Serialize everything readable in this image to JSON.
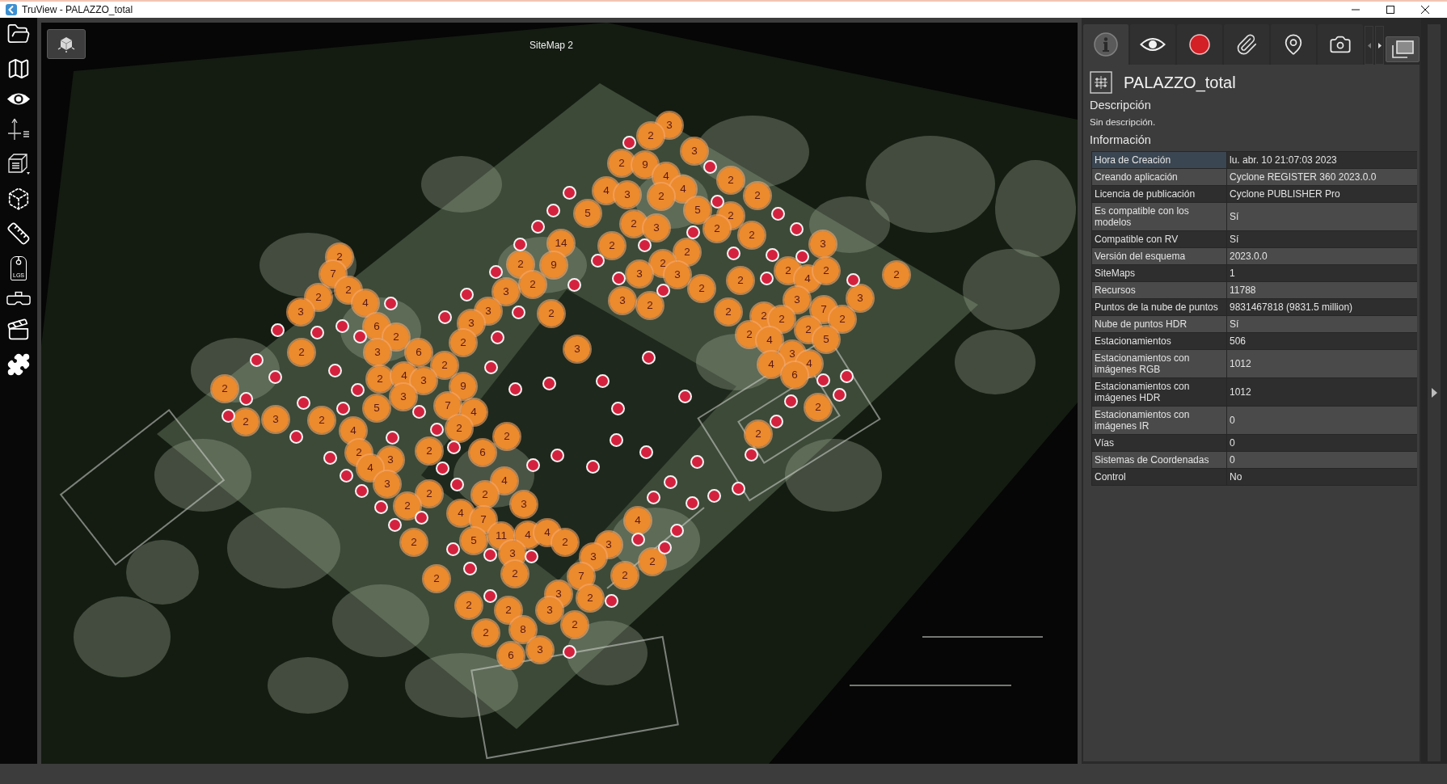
{
  "window": {
    "title": "TruView - PALAZZO_total"
  },
  "toolbar": {
    "tag_text": "LGS"
  },
  "viewport": {
    "sitemap_label": "SiteMap 2",
    "clusters": [
      {
        "count": "3"
      },
      {
        "count": "2"
      },
      {
        "count": "3"
      },
      {
        "count": "2"
      },
      {
        "count": "9"
      },
      {
        "count": "4"
      },
      {
        "count": "4"
      },
      {
        "count": "2"
      },
      {
        "count": "4"
      },
      {
        "count": "3"
      },
      {
        "count": "2"
      },
      {
        "count": "2"
      },
      {
        "count": "5"
      },
      {
        "count": "5"
      },
      {
        "count": "2"
      },
      {
        "count": "2"
      },
      {
        "count": "3"
      },
      {
        "count": "2"
      },
      {
        "count": "14"
      },
      {
        "count": "2"
      },
      {
        "count": "2"
      },
      {
        "count": "2"
      },
      {
        "count": "3"
      },
      {
        "count": "2"
      },
      {
        "count": "2"
      },
      {
        "count": "9"
      },
      {
        "count": "2"
      },
      {
        "count": "7"
      },
      {
        "count": "3"
      },
      {
        "count": "3"
      },
      {
        "count": "2"
      },
      {
        "count": "4"
      },
      {
        "count": "2"
      },
      {
        "count": "2"
      },
      {
        "count": "2"
      },
      {
        "count": "2"
      },
      {
        "count": "3"
      },
      {
        "count": "2"
      },
      {
        "count": "2"
      },
      {
        "count": "2"
      },
      {
        "count": "4"
      },
      {
        "count": "3"
      },
      {
        "count": "2"
      },
      {
        "count": "3"
      },
      {
        "count": "3"
      },
      {
        "count": "3"
      },
      {
        "count": "3"
      },
      {
        "count": "2"
      },
      {
        "count": "2"
      },
      {
        "count": "2"
      },
      {
        "count": "7"
      },
      {
        "count": "6"
      },
      {
        "count": "3"
      },
      {
        "count": "2"
      },
      {
        "count": "2"
      },
      {
        "count": "2"
      },
      {
        "count": "2"
      },
      {
        "count": "2"
      },
      {
        "count": "2"
      },
      {
        "count": "4"
      },
      {
        "count": "5"
      },
      {
        "count": "2"
      },
      {
        "count": "3"
      },
      {
        "count": "6"
      },
      {
        "count": "3"
      },
      {
        "count": "3"
      },
      {
        "count": "2"
      },
      {
        "count": "4"
      },
      {
        "count": "4"
      },
      {
        "count": "2"
      },
      {
        "count": "4"
      },
      {
        "count": "3"
      },
      {
        "count": "6"
      },
      {
        "count": "2"
      },
      {
        "count": "9"
      },
      {
        "count": "3"
      },
      {
        "count": "5"
      },
      {
        "count": "7"
      },
      {
        "count": "4"
      },
      {
        "count": "2"
      },
      {
        "count": "2"
      },
      {
        "count": "3"
      },
      {
        "count": "2"
      },
      {
        "count": "4"
      },
      {
        "count": "2"
      },
      {
        "count": "2"
      },
      {
        "count": "2"
      },
      {
        "count": "2"
      },
      {
        "count": "3"
      },
      {
        "count": "2"
      },
      {
        "count": "6"
      },
      {
        "count": "4"
      },
      {
        "count": "3"
      },
      {
        "count": "4"
      },
      {
        "count": "2"
      },
      {
        "count": "2"
      },
      {
        "count": "2"
      },
      {
        "count": "4"
      },
      {
        "count": "3"
      },
      {
        "count": "7"
      },
      {
        "count": "4"
      },
      {
        "count": "5"
      },
      {
        "count": "11"
      },
      {
        "count": "4"
      },
      {
        "count": "4"
      },
      {
        "count": "2"
      },
      {
        "count": "2"
      },
      {
        "count": "3"
      },
      {
        "count": "3"
      },
      {
        "count": "3"
      },
      {
        "count": "2"
      },
      {
        "count": "2"
      },
      {
        "count": "2"
      },
      {
        "count": "7"
      },
      {
        "count": "2"
      },
      {
        "count": "3"
      },
      {
        "count": "2"
      },
      {
        "count": "2"
      },
      {
        "count": "2"
      },
      {
        "count": "3"
      },
      {
        "count": "2"
      },
      {
        "count": "8"
      },
      {
        "count": "2"
      },
      {
        "count": "6"
      },
      {
        "count": "3"
      }
    ]
  },
  "panel": {
    "tabs": [
      {
        "selected": true
      },
      {
        "selected": false
      },
      {
        "selected": false
      },
      {
        "selected": false
      },
      {
        "selected": false
      },
      {
        "selected": false
      }
    ],
    "title": "PALAZZO_total",
    "description_heading": "Descripción",
    "description": "Sin descripción.",
    "info_heading": "Información",
    "info_rows": [
      {
        "label": "Hora de Creación",
        "value": "lu. abr. 10 21:07:03 2023",
        "selected": true
      },
      {
        "label": "Creando aplicación",
        "value": "Cyclone REGISTER 360 2023.0.0",
        "selected": false
      },
      {
        "label": "Licencia de publicación",
        "value": "Cyclone PUBLISHER Pro",
        "selected": false
      },
      {
        "label": "Es compatible con los modelos",
        "value": "Sí",
        "selected": false
      },
      {
        "label": "Compatible con RV",
        "value": "Sí",
        "selected": false
      },
      {
        "label": "Versión del esquema",
        "value": "2023.0.0",
        "selected": false
      },
      {
        "label": "SiteMaps",
        "value": "1",
        "selected": false
      },
      {
        "label": "Recursos",
        "value": "11788",
        "selected": false
      },
      {
        "label": "Puntos de la nube de puntos",
        "value": "9831467818 (9831.5 million)",
        "selected": false
      },
      {
        "label": "Nube de puntos HDR",
        "value": "Sí",
        "selected": false
      },
      {
        "label": "Estacionamientos",
        "value": "506",
        "selected": false
      },
      {
        "label": "Estacionamientos con imágenes RGB",
        "value": "1012",
        "selected": false
      },
      {
        "label": "Estacionamientos con imágenes HDR",
        "value": "1012",
        "selected": false
      },
      {
        "label": "Estacionamientos con imágenes IR",
        "value": "0",
        "selected": false
      },
      {
        "label": "Vías",
        "value": "0",
        "selected": false
      },
      {
        "label": "Sistemas de Coordenadas",
        "value": "0",
        "selected": false
      },
      {
        "label": "Control",
        "value": "No",
        "selected": false
      }
    ]
  }
}
